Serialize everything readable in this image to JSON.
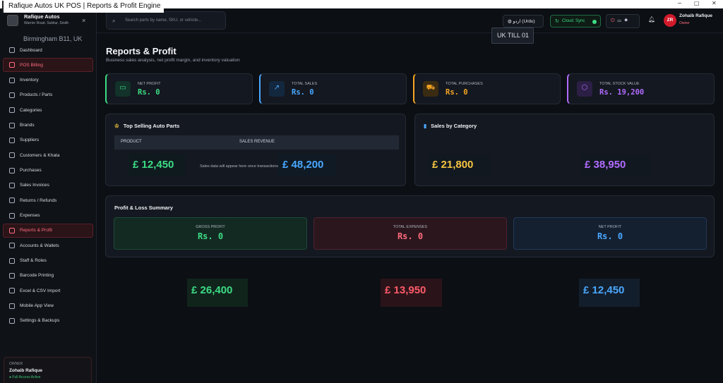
{
  "window": {
    "title": "Rafique Autos UK POS | Reports & Profit Engine",
    "controls": [
      "−",
      "□",
      "✕"
    ]
  },
  "sidebar": {
    "brand_name": "Rafique Autos",
    "brand_address": "Warrior Road, Sukkur, Sindh",
    "close": "×",
    "location": "Birmingham B11, UK",
    "items": [
      {
        "label": "Dashboard",
        "icon": "grid-icon"
      },
      {
        "label": "POS Billing",
        "icon": "cart-icon"
      },
      {
        "label": "Inventory",
        "icon": "box-icon"
      },
      {
        "label": "Products / Parts",
        "icon": "parts-icon"
      },
      {
        "label": "Categories",
        "icon": "tag-icon"
      },
      {
        "label": "Brands",
        "icon": "brand-icon"
      },
      {
        "label": "Suppliers",
        "icon": "truck-icon"
      },
      {
        "label": "Customers & Khata",
        "icon": "users-icon"
      },
      {
        "label": "Purchases",
        "icon": "clipboard-icon"
      },
      {
        "label": "Sales Invoices",
        "icon": "receipt-icon"
      },
      {
        "label": "Returns / Refunds",
        "icon": "return-icon"
      },
      {
        "label": "Expenses",
        "icon": "wallet-icon"
      },
      {
        "label": "Reports & Profit",
        "icon": "chart-icon"
      },
      {
        "label": "Accounts & Wallets",
        "icon": "account-icon"
      },
      {
        "label": "Staff & Roles",
        "icon": "staff-icon"
      },
      {
        "label": "Barcode Printing",
        "icon": "barcode-icon"
      },
      {
        "label": "Excel & CSV Import",
        "icon": "import-icon"
      },
      {
        "label": "Mobile App View",
        "icon": "mobile-icon"
      },
      {
        "label": "Settings & Backups",
        "icon": "settings-icon"
      }
    ],
    "owner": {
      "role": "OWNER",
      "name": "Zohaib Rafique",
      "status": "● Full Access Active"
    }
  },
  "topbar": {
    "search_placeholder": "Search parts by name, SKU, or vehicle...",
    "language": "اردو (Urdu)",
    "sync": "Cloud: Sync",
    "user_initials": "ZR",
    "user_name": "Zohaib Rafique",
    "user_role": "Owner",
    "till": "UK TILL 01"
  },
  "page": {
    "title": "Reports & Profit",
    "subtitle": "Business sales analysis, net profit margin, and inventory valuation"
  },
  "cards": [
    {
      "label": "NET PROFIT",
      "value": "Rs. 0",
      "color": "#3ddc84",
      "icon": "money-icon"
    },
    {
      "label": "TOTAL SALES",
      "value": "Rs. 0",
      "color": "#4aa8ff",
      "icon": "trend-up-icon"
    },
    {
      "label": "TOTAL PURCHASES",
      "value": "Rs. 0",
      "color": "#f5a524",
      "icon": "cart-icon"
    },
    {
      "label": "TOTAL STOCK VALUE",
      "value": "Rs. 19,200",
      "color": "#b06cff",
      "icon": "cube-icon"
    }
  ],
  "top_selling": {
    "title": "Top Selling Auto Parts",
    "col_product": "PRODUCT",
    "col_revenue": "SALES REVENUE",
    "empty": "Sales data will appear here once transactions are made",
    "overlay_a": "£ 12,450",
    "overlay_b": "£ 48,200"
  },
  "by_category": {
    "title": "Sales by Category",
    "overlay_a": "£ 21,800",
    "overlay_b": "£ 38,950"
  },
  "pl": {
    "title": "Profit & Loss Summary",
    "gross_label": "GROSS PROFIT",
    "gross_value": "Rs. 0",
    "exp_label": "TOTAL EXPENSES",
    "exp_value": "Rs. 0",
    "net_label": "NET PROFIT",
    "net_value": "Rs. 0"
  },
  "bottom": {
    "a": "£ 26,400",
    "b": "£ 13,950",
    "c": "£ 12,450"
  }
}
